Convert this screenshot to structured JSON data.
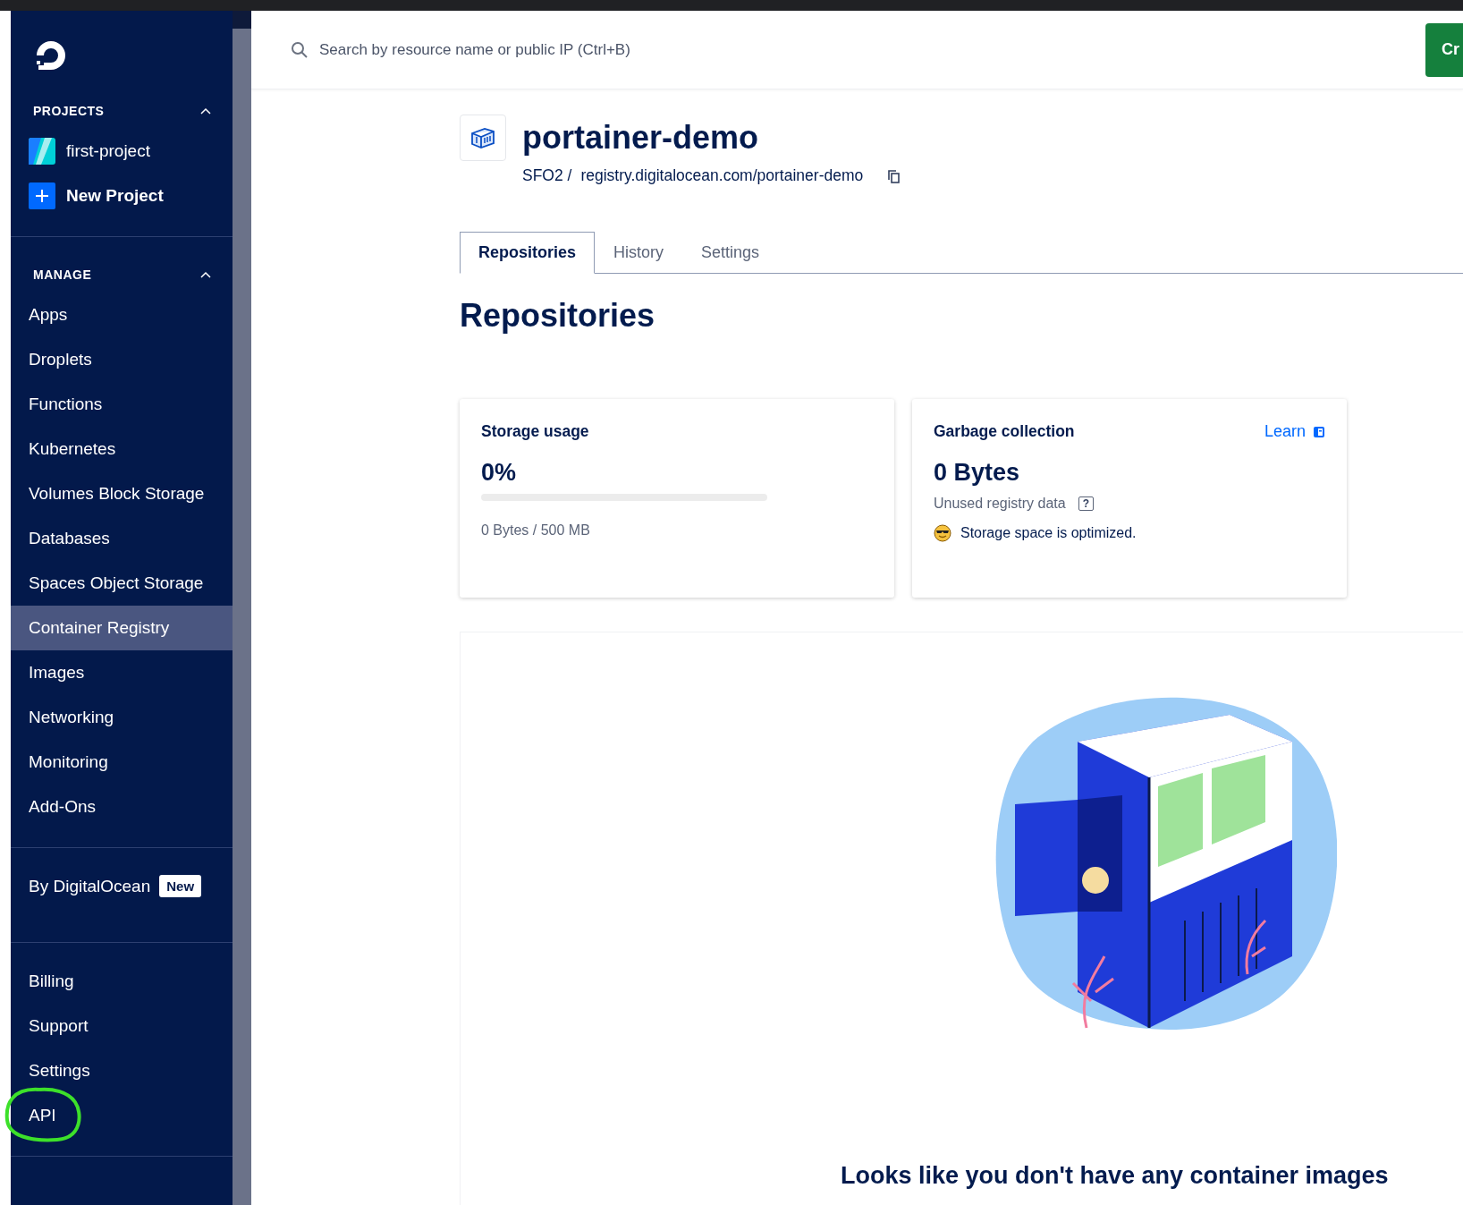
{
  "sidebar": {
    "projects": {
      "title": "PROJECTS",
      "expanded": true,
      "items": [
        {
          "kind": "project",
          "label": "first-project"
        },
        {
          "kind": "new",
          "label": "New Project"
        }
      ]
    },
    "manage": {
      "title": "MANAGE",
      "expanded": true,
      "items": [
        {
          "label": "Apps",
          "selected": false
        },
        {
          "label": "Droplets",
          "selected": false
        },
        {
          "label": "Functions",
          "selected": false
        },
        {
          "label": "Kubernetes",
          "selected": false
        },
        {
          "label": "Volumes Block Storage",
          "selected": false
        },
        {
          "label": "Databases",
          "selected": false
        },
        {
          "label": "Spaces Object Storage",
          "selected": false
        },
        {
          "label": "Container Registry",
          "selected": true
        },
        {
          "label": "Images",
          "selected": false
        },
        {
          "label": "Networking",
          "selected": false
        },
        {
          "label": "Monitoring",
          "selected": false
        },
        {
          "label": "Add-Ons",
          "selected": false
        }
      ]
    },
    "promo": {
      "label": "By DigitalOcean",
      "badge": "New"
    },
    "account": [
      {
        "label": "Billing",
        "circled": false
      },
      {
        "label": "Support",
        "circled": false
      },
      {
        "label": "Settings",
        "circled": false
      },
      {
        "label": "API",
        "circled": true
      }
    ]
  },
  "header": {
    "search": {
      "placeholder": "Search by resource name or public IP (Ctrl+B)"
    },
    "button": "Cr"
  },
  "registry": {
    "name": "portainer-demo",
    "region": "SFO2 /",
    "url": "registry.digitalocean.com/portainer-demo"
  },
  "tabs": [
    {
      "label": "Repositories",
      "selected": true
    },
    {
      "label": "History",
      "selected": false
    },
    {
      "label": "Settings",
      "selected": false
    }
  ],
  "heading": "Repositories",
  "storage": {
    "title": "Storage usage",
    "value": "0%",
    "level": 0,
    "detail": "0 Bytes / 500 MB"
  },
  "garbage": {
    "title": "Garbage collection",
    "link": "Learn",
    "value": "0 Bytes",
    "caption": "Unused registry data",
    "help": "?",
    "status": "Storage space is optimized."
  },
  "empty": {
    "message": "Looks like you don't have any container images"
  }
}
